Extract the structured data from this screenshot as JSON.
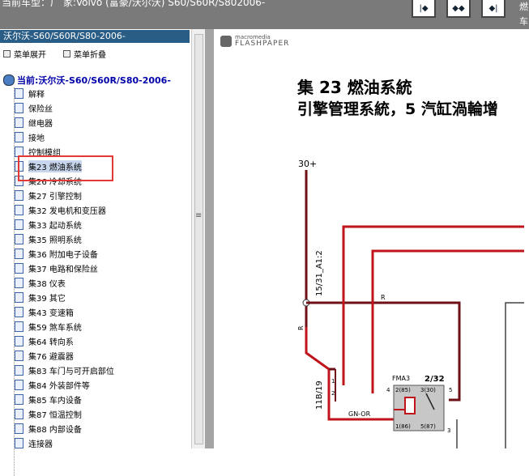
{
  "window": {
    "title": "当前车型：厂 家:Volvo (富豪/沃尔沃) S60/S60R/S802006-",
    "right_letters": [
      "燃",
      "车"
    ],
    "nav_buttons": [
      "|◆",
      "◆◆",
      "◆|"
    ]
  },
  "sidebar": {
    "header": "沃尔沃-S60/S60R/S80-2006-",
    "expand_label": "菜单展开",
    "collapse_label": "菜单折叠",
    "root_label": "当前:沃尔沃-S60/S60R/S80-2006-",
    "items": [
      "解释",
      "保险丝",
      "继电器",
      "接地",
      "控制模组",
      "集23 燃油系统",
      "集26 冷却系统",
      "集27 引擎控制",
      "集32 发电机和变压器",
      "集33 起动系统",
      "集35 照明系统",
      "集36 附加电子设备",
      "集37 电路和保险丝",
      "集38 仪表",
      "集39 其它",
      "集43 变速箱",
      "集59 煞车系统",
      "集64 转向系",
      "集76 避震器",
      "集83 车门与可开启部位",
      "集84 外装部件等",
      "集85 车内设备",
      "集87 恒温控制",
      "集88 内部设备",
      "连接器"
    ],
    "selected_index": 5
  },
  "viewer": {
    "logo_line1": "macromedia",
    "logo_line2": "FLASHPAPER",
    "chapter_title": "集 23 燃油系統",
    "subtitle": "引擎管理系統，5 汽缸渦輪增",
    "diagram": {
      "label_30": "30+",
      "wire_15": "15/31_A1:2",
      "wire_11b": "11B/19",
      "label_r1": "R",
      "label_r2": "R",
      "label_gnor": "GN-OR",
      "relay_name": "FMA3",
      "relay_code": "2/32",
      "pin_1": "1",
      "pin_2": "2",
      "pin_4": "4",
      "pin_5": "5",
      "pin_3": "3",
      "pin_txt_2": "2(85)",
      "pin_txt_3": "3(30)",
      "pin_txt_1": "1(86)",
      "pin_txt_5": "5(87)"
    }
  },
  "colors": {
    "wire_red": "#c0141c",
    "wire_darkred": "#6e1018",
    "sidebar_header": "#2a5d86",
    "highlight": "#e53935"
  }
}
